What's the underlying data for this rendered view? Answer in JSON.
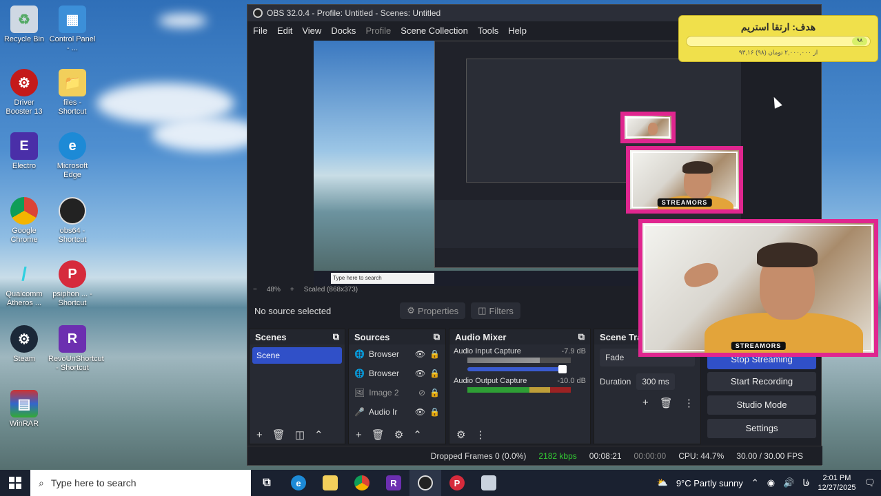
{
  "desktop": {
    "icons": [
      {
        "label": "Recycle Bin",
        "icon": "recycle-bin-icon"
      },
      {
        "label": "Control Panel - ...",
        "icon": "control-panel-icon"
      },
      {
        "label": "Driver Booster 13",
        "icon": "driver-booster-icon"
      },
      {
        "label": "files - Shortcut",
        "icon": "folder-icon"
      },
      {
        "label": "Electro",
        "icon": "electro-icon"
      },
      {
        "label": "Microsoft Edge",
        "icon": "edge-icon"
      },
      {
        "label": "Google Chrome",
        "icon": "chrome-icon"
      },
      {
        "label": "obs64 - Shortcut",
        "icon": "obs-icon"
      },
      {
        "label": "Qualcomm Atheros ...",
        "icon": "qualcomm-icon"
      },
      {
        "label": "psiphon ... - Shortcut",
        "icon": "psiphon-icon"
      },
      {
        "label": "Steam",
        "icon": "steam-icon"
      },
      {
        "label": "RevoUnShortcut - Shortcut",
        "icon": "revo-icon"
      },
      {
        "label": "WinRAR",
        "icon": "winrar-icon"
      }
    ]
  },
  "obs": {
    "title": "OBS 32.0.4 - Profile: Untitled - Scenes: Untitled",
    "menu": [
      "File",
      "Edit",
      "View",
      "Docks",
      "Profile",
      "Scene Collection",
      "Tools",
      "Help"
    ],
    "zoom": "48%",
    "scaled": "Scaled (868x373)",
    "no_source": "No source selected",
    "properties_label": "Properties",
    "filters_label": "Filters",
    "scenes": {
      "header": "Scenes",
      "items": [
        "Scene"
      ]
    },
    "sources": {
      "header": "Sources",
      "items": [
        "Browser",
        "Browser",
        "Image 2",
        "Audio Ir"
      ]
    },
    "mixer": {
      "header": "Audio Mixer",
      "channels": [
        {
          "name": "Audio Input Capture",
          "db": "-7.9 dB"
        },
        {
          "name": "Audio Output Capture",
          "db": "-10.0 dB"
        }
      ]
    },
    "transitions": {
      "header": "Scene Tra",
      "type": "Fade",
      "duration_label": "Duration",
      "duration_value": "300 ms"
    },
    "controls": [
      "Stop Streaming",
      "Start Recording",
      "Studio Mode",
      "Settings"
    ],
    "status": {
      "dropped": "Dropped Frames 0 (0.0%)",
      "kbps": "2182 kbps",
      "stream_time": "00:08:21",
      "rec_time": "00:00:00",
      "cpu": "CPU: 44.7%",
      "fps": "30.00 / 30.00 FPS"
    }
  },
  "donation": {
    "title": "هدف: ارتقا استریم",
    "amount": "۹۳,۱۶ از ۲,۰۰۰,۰۰۰ تومان (۹۸)",
    "percent": "۹۸"
  },
  "webcam": {
    "tag": "STREAMORS"
  },
  "taskbar": {
    "search_placeholder": "Type here to search",
    "weather": "9°C  Partly sunny",
    "lang": "فا",
    "time": "2:01 PM",
    "date": "12/27/2025"
  },
  "colors": {
    "accent": "#3050c8",
    "frame": "#e0268f",
    "widget": "#f0e04b"
  }
}
